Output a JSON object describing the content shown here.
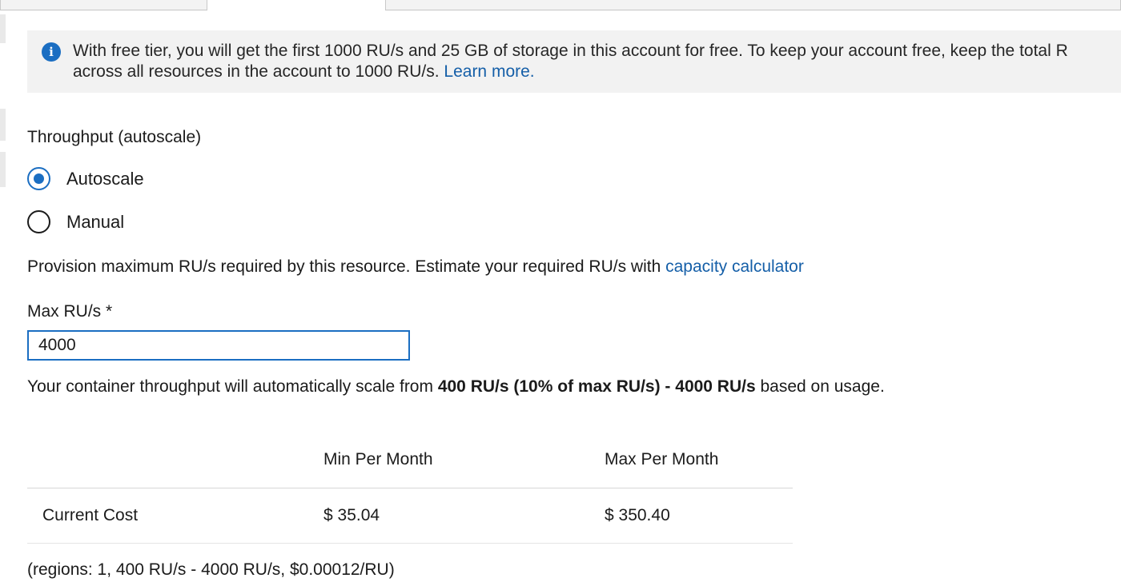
{
  "info_banner": {
    "icon": "info-icon",
    "text": "With free tier, you will get the first 1000 RU/s and 25 GB of storage in this account for free. To keep your account free, keep the total R",
    "text_line2": "across all resources in the account to 1000 RU/s.",
    "link": "Learn more."
  },
  "throughput": {
    "title": "Throughput (autoscale)",
    "options": [
      {
        "label": "Autoscale",
        "selected": true
      },
      {
        "label": "Manual",
        "selected": false
      }
    ]
  },
  "provision": {
    "text": "Provision maximum RU/s required by this resource. Estimate your required RU/s with",
    "link": "capacity calculator"
  },
  "max_rus": {
    "label": "Max RU/s *",
    "value": "4000"
  },
  "scale_note": {
    "prefix": "Your container throughput will automatically scale from",
    "bold": "400 RU/s (10% of max RU/s) - 4000 RU/s",
    "suffix": "based on usage."
  },
  "cost_table": {
    "headers": [
      "",
      "Min Per Month",
      "Max Per Month"
    ],
    "rows": [
      {
        "label": "Current Cost",
        "min": "$ 35.04",
        "max": "$ 350.40"
      }
    ]
  },
  "regions_note": "(regions: 1, 400 RU/s - 4000 RU/s, $0.00012/RU)",
  "colors": {
    "accent": "#1b6ec2",
    "link": "#155fa8",
    "banner_bg": "#f2f2f2"
  }
}
